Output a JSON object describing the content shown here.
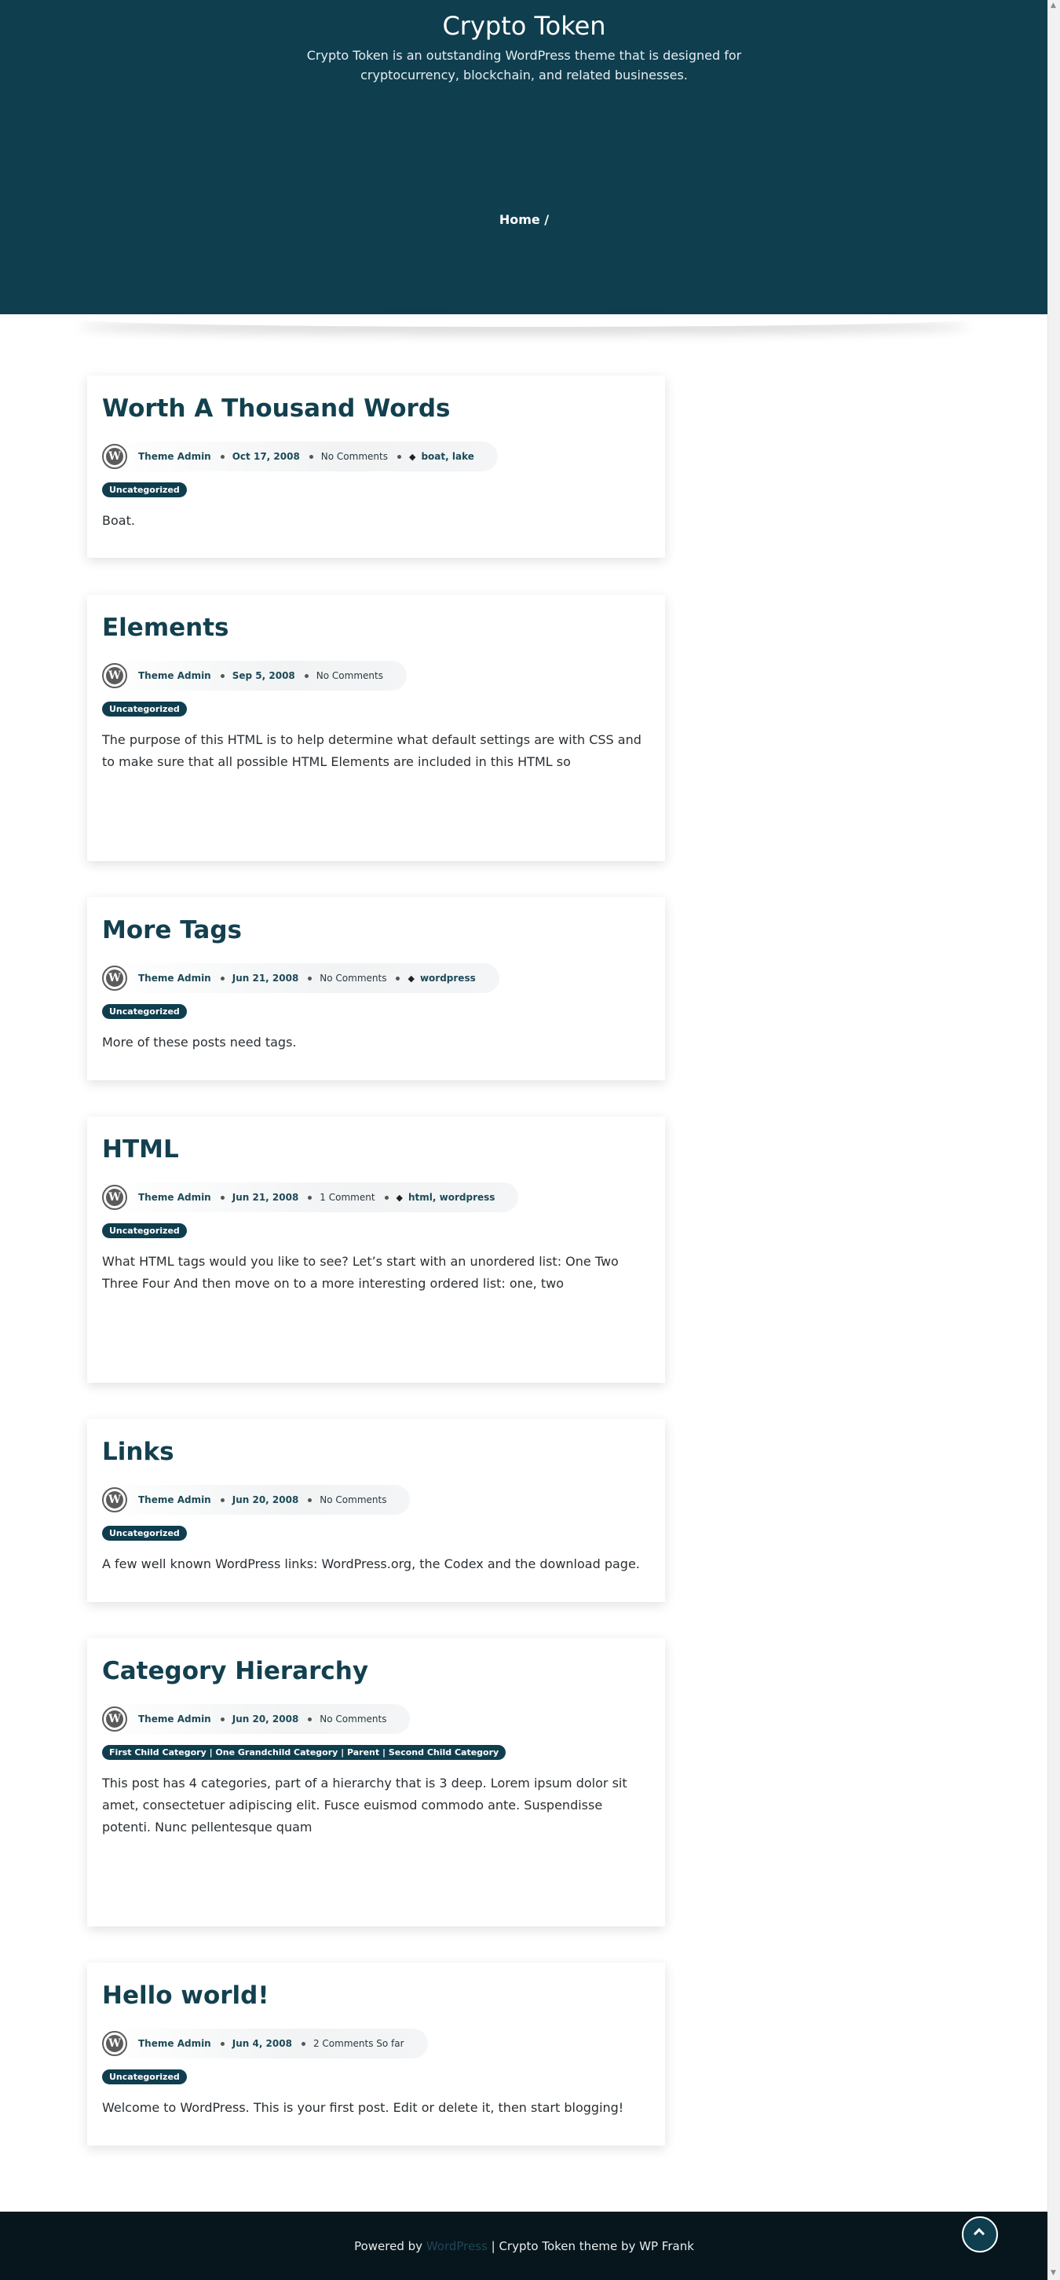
{
  "header": {
    "site_title": "Crypto Token",
    "site_description": "Crypto Token is an outstanding WordPress theme that is designed for cryptocurrency, blockchain, and related businesses.",
    "breadcrumb": "Home /"
  },
  "posts": [
    {
      "title": "Worth A Thousand Words",
      "author": "Theme Admin",
      "date": "Oct 17, 2008",
      "comments": "No Comments",
      "tags": "boat, lake",
      "category": "Uncategorized",
      "excerpt": "Boat."
    },
    {
      "title": "Elements",
      "author": "Theme Admin",
      "date": "Sep 5, 2008",
      "comments": "No Comments",
      "category": "Uncategorized",
      "excerpt": "The purpose of this HTML is to help determine what default settings are with CSS and to make sure that all possible HTML Elements are included in this HTML so"
    },
    {
      "title": "More Tags",
      "author": "Theme Admin",
      "date": "Jun 21, 2008",
      "comments": "No Comments",
      "tags": "wordpress",
      "category": "Uncategorized",
      "excerpt": "More of these posts need tags."
    },
    {
      "title": "HTML",
      "author": "Theme Admin",
      "date": "Jun 21, 2008",
      "comments": "1 Comment",
      "tags": "html, wordpress",
      "category": "Uncategorized",
      "excerpt": "What HTML tags would you like to see? Let’s start with an unordered list: One Two Three Four And then move on to a more interesting ordered list: one, two"
    },
    {
      "title": "Links",
      "author": "Theme Admin",
      "date": "Jun 20, 2008",
      "comments": "No Comments",
      "category": "Uncategorized",
      "excerpt": "A few well known WordPress links: WordPress.org, the Codex and the download page."
    },
    {
      "title": "Category Hierarchy",
      "author": "Theme Admin",
      "date": "Jun 20, 2008",
      "comments": "No Comments",
      "category": "First Child Category | One Grandchild Category | Parent | Second Child Category",
      "excerpt": "This post has 4 categories, part of a hierarchy that is 3 deep. Lorem ipsum dolor sit amet, consectetuer adipiscing elit. Fusce euismod commodo ante. Suspendisse potenti. Nunc pellentesque quam"
    },
    {
      "title": "Hello world!",
      "author": "Theme Admin",
      "date": "Jun 4, 2008",
      "comments": "2 Comments So far",
      "category": "Uncategorized",
      "excerpt": "Welcome to WordPress. This is your first post. Edit or delete it, then start blogging!"
    }
  ],
  "footer": {
    "powered_by": "Powered by",
    "wordpress_link": "WordPress",
    "theme_credit": "| Crypto Token theme by WP Frank"
  },
  "icons": {
    "avatar": "wordpress-logo-icon",
    "tag": "tag-icon",
    "scroll_top": "chevron-up-icon"
  },
  "colors": {
    "header_bg": "#0f3e4f",
    "footer_bg": "#06161c",
    "title_color": "#13404f"
  }
}
